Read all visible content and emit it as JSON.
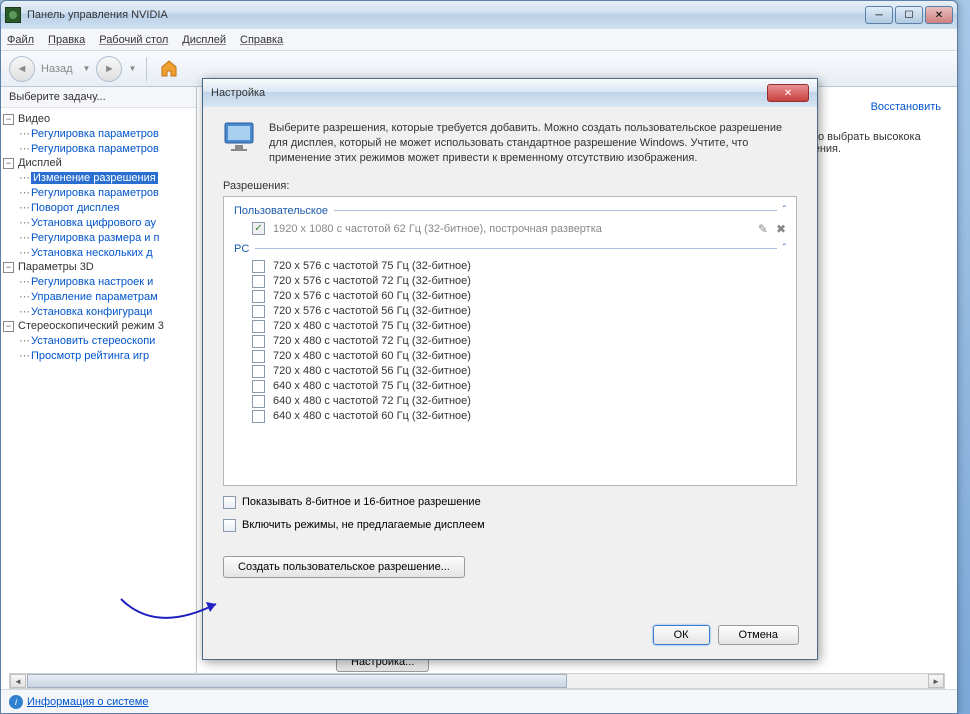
{
  "window": {
    "title": "Панель управления NVIDIA"
  },
  "menu": {
    "file": "Файл",
    "edit": "Правка",
    "desktop": "Рабочий стол",
    "display": "Дисплей",
    "help": "Справка"
  },
  "toolbar": {
    "back": "Назад"
  },
  "sidebar": {
    "header": "Выберите задачу...",
    "groups": [
      {
        "label": "Видео",
        "items": [
          "Регулировка параметров",
          "Регулировка параметров"
        ]
      },
      {
        "label": "Дисплей",
        "items": [
          "Изменение разрешения",
          "Регулировка параметров",
          "Поворот дисплея",
          "Установка цифрового ау",
          "Регулировка размера и п",
          "Установка нескольких д"
        ]
      },
      {
        "label": "Параметры 3D",
        "items": [
          "Регулировка настроек и",
          "Управление параметрам",
          "Установка конфигураци"
        ]
      },
      {
        "label": "Стереоскопический режим 3",
        "items": [
          "Установить стереоскопи",
          "Просмотр рейтинга игр"
        ]
      }
    ],
    "selected": "Изменение разрешения"
  },
  "main": {
    "restore": "Восстановить",
    "text_line1": "е. Можно выбрать высокока",
    "text_line2": "елевидения.",
    "settings_btn": "Настройка..."
  },
  "status": {
    "info": "Информация о системе"
  },
  "dialog": {
    "title": "Настройка",
    "intro": "Выберите разрешения, которые требуется добавить. Можно создать пользовательское разрешение для дисплея, который не может использовать стандартное разрешение Windows. Учтите, что применение этих режимов может привести к временному отсутствию изображения.",
    "res_label": "Разрешения:",
    "group_custom": "Пользовательское",
    "custom_item": "1920 x 1080 с частотой 62 Гц (32-битное), построчная развертка",
    "group_pc": "PC",
    "pc_items": [
      "720 x 576 с частотой 75 Гц (32-битное)",
      "720 x 576 с частотой 72 Гц (32-битное)",
      "720 x 576 с частотой 60 Гц (32-битное)",
      "720 x 576 с частотой 56 Гц (32-битное)",
      "720 x 480 с частотой 75 Гц (32-битное)",
      "720 x 480 с частотой 72 Гц (32-битное)",
      "720 x 480 с частотой 60 Гц (32-битное)",
      "720 x 480 с частотой 56 Гц (32-битное)",
      "640 x 480 с частотой 75 Гц (32-битное)",
      "640 x 480 с частотой 72 Гц (32-битное)",
      "640 x 480 с частотой 60 Гц (32-битное)"
    ],
    "opt_8_16": "Показывать 8-битное и 16-битное разрешение",
    "opt_include": "Включить режимы, не предлагаемые дисплеем",
    "create_btn": "Создать пользовательское разрешение...",
    "ok": "ОК",
    "cancel": "Отмена"
  }
}
